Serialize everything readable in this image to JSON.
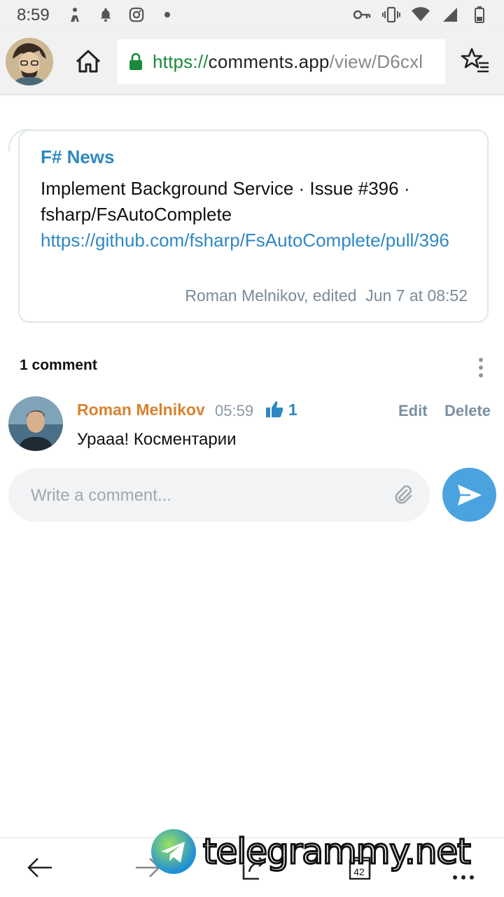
{
  "status_bar": {
    "time": "8:59",
    "left_icons": [
      "person-transfer-icon",
      "bell-icon",
      "instagram-icon",
      "dot-icon"
    ],
    "right_icons": [
      "key-icon",
      "vibrate-icon",
      "wifi-icon",
      "signal-icon",
      "battery-icon"
    ]
  },
  "browser": {
    "url_scheme": "https://",
    "url_host": "comments.app",
    "url_path": "/view/D6cxl",
    "icons": [
      "profile-avatar",
      "home-icon",
      "lock-icon",
      "star-list-icon"
    ]
  },
  "post": {
    "channel": "F# News",
    "text": "Implement Background Service · Issue #396 · fsharp/FsAutoComplete",
    "link": "https://github.com/fsharp/FsAutoComplete/pull/396",
    "meta": "Roman Melnikov, edited  Jun 7 at 08:52"
  },
  "comments": {
    "count_label": "1 comment",
    "items": [
      {
        "author": "Roman Melnikov",
        "time": "05:59",
        "likes": "1",
        "edit_label": "Edit",
        "delete_label": "Delete",
        "text": "Урааа! Косментарии"
      }
    ],
    "input_placeholder": "Write a comment..."
  },
  "bottom_bar": {
    "tabs_count": "42",
    "icons": [
      "back-arrow-icon",
      "forward-arrow-icon",
      "share-icon",
      "tabs-icon",
      "more-icon"
    ]
  },
  "watermark": {
    "text": "telegrammy.net"
  },
  "colors": {
    "accent": "#2e88c3",
    "author": "#d7822f",
    "send_button": "#4aa3df",
    "secure": "#1b8a3c"
  }
}
